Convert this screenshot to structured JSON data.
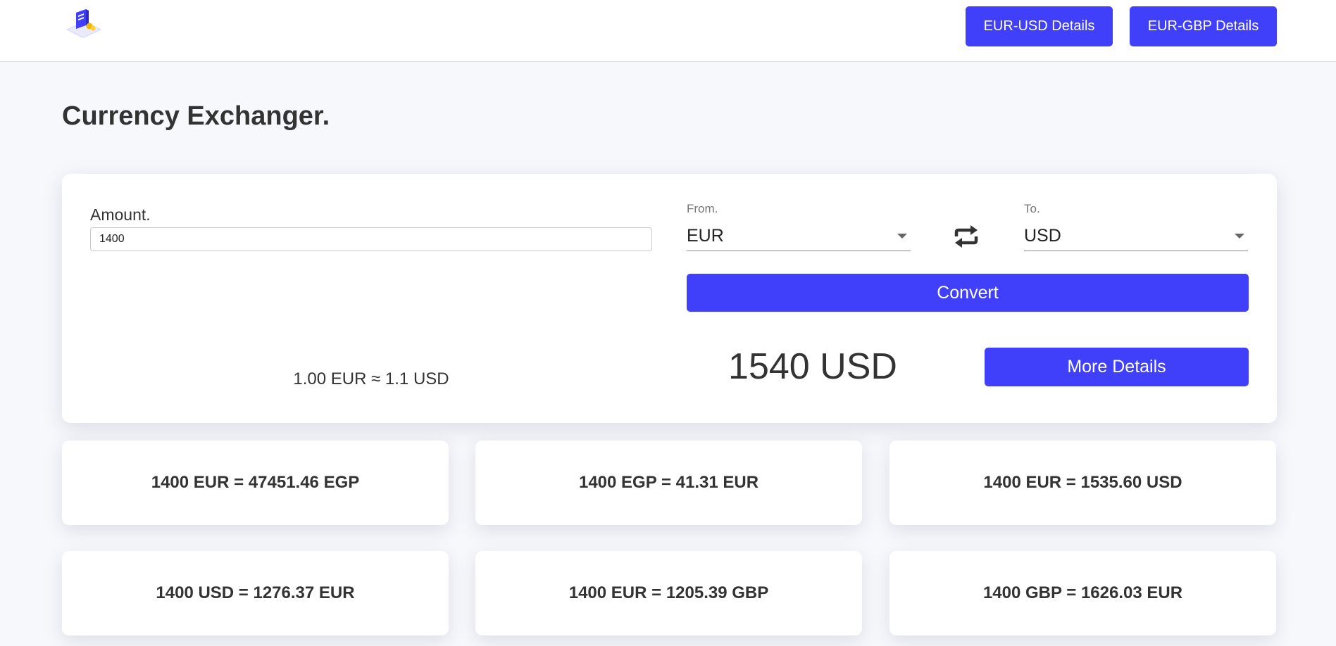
{
  "header": {
    "buttons": [
      {
        "label": "EUR-USD Details"
      },
      {
        "label": "EUR-GBP Details"
      }
    ]
  },
  "page": {
    "title": "Currency Exchanger."
  },
  "converter": {
    "amount_label": "Amount.",
    "amount_value": "1400",
    "from_label": "From.",
    "from_value": "EUR",
    "to_label": "To.",
    "to_value": "USD",
    "convert_label": "Convert",
    "rate_text": "1.00 EUR ≈ 1.1 USD",
    "result_text": "1540 USD",
    "more_details_label": "More Details"
  },
  "cards": [
    {
      "text": "1400 EUR = 47451.46 EGP"
    },
    {
      "text": "1400 EGP = 41.31 EUR"
    },
    {
      "text": "1400 EUR = 1535.60 USD"
    },
    {
      "text": "1400 USD = 1276.37 EUR"
    },
    {
      "text": "1400 EUR = 1205.39 GBP"
    },
    {
      "text": "1400 GBP = 1626.03 EUR"
    }
  ],
  "colors": {
    "accent": "#4040fb",
    "background": "#f7f8fc",
    "text": "#333333"
  }
}
